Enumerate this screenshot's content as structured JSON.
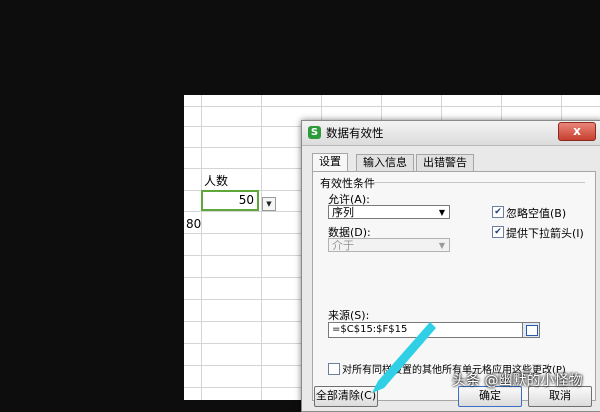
{
  "sheet": {
    "header_cell": "人数",
    "active_value": "50",
    "side_value": "80"
  },
  "dialog": {
    "title": "数据有效性",
    "close_label": "x",
    "tabs": [
      "设置",
      "输入信息",
      "出错警告"
    ],
    "group_title": "有效性条件",
    "allow_label": "允许(A):",
    "allow_value": "序列",
    "data_label": "数据(D):",
    "data_value": "介于",
    "ignore_blank_label": "忽略空值(B)",
    "dropdown_arrow_label": "提供下拉箭头(I)",
    "source_label": "来源(S):",
    "source_value": "=$C$15:$F$15",
    "apply_all_label": "对所有同样设置的其他所有单元格应用这些更改(P)",
    "clear_all_button": "全部清除(C)",
    "ok_button": "确定",
    "cancel_button": "取消"
  },
  "watermark": "头条 @幽默的小怪物",
  "colors": {
    "active_cell_border": "#5fa73a",
    "annotation_arrow": "#2fd0e6"
  }
}
